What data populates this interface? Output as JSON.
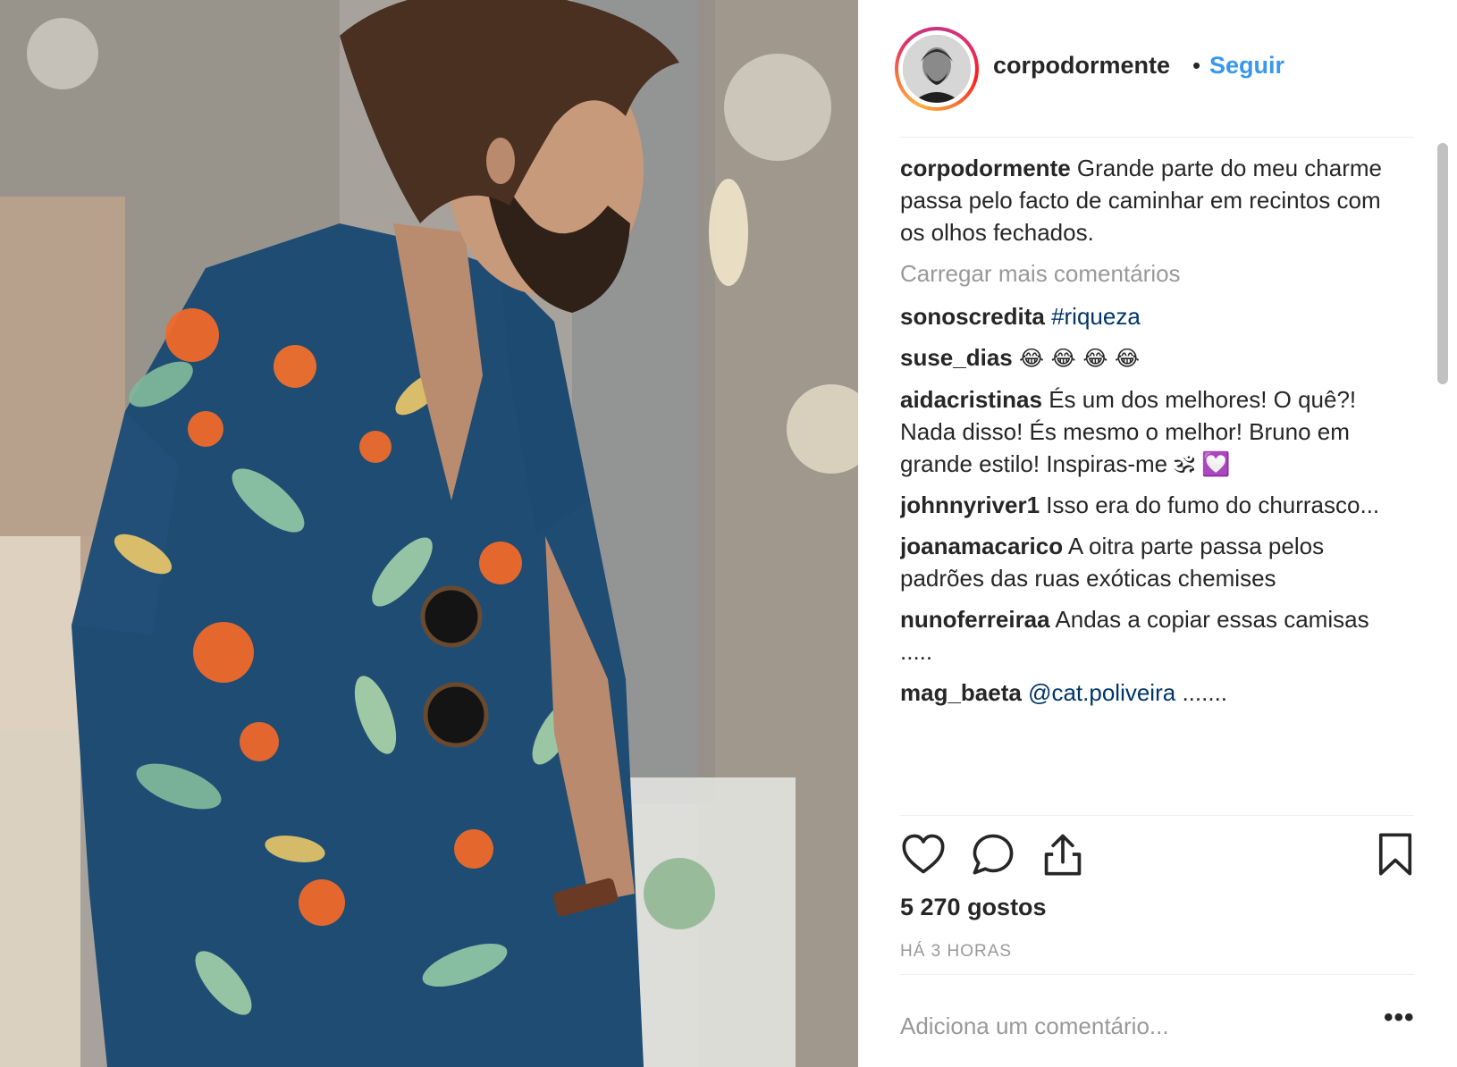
{
  "colors": {
    "accent_link": "#3897f0",
    "hashtag": "#003569",
    "muted": "#999999",
    "text": "#262626"
  },
  "header": {
    "username": "corpodormente",
    "separator": "•",
    "follow_label": "Seguir"
  },
  "caption": {
    "user": "corpodormente",
    "text": "Grande parte do meu charme passa pelo facto de caminhar em recintos com os olhos fechados."
  },
  "load_more": "Carregar mais comentários",
  "comments": [
    {
      "user": "sonoscredita",
      "tag": "#riqueza",
      "text": ""
    },
    {
      "user": "suse_dias",
      "text": "😂 😂 😂 😂"
    },
    {
      "user": "aidacristinas",
      "text": "És um dos melhores! O quê?! Nada disso! És mesmo o melhor! Bruno em grande estilo! Inspiras-me 🕉 💟"
    },
    {
      "user": "johnnyriver1",
      "text": "Isso era do fumo do churrasco..."
    },
    {
      "user": "joanamacarico",
      "text": "A oitra parte passa pelos padrões das ruas exóticas chemises"
    },
    {
      "user": "nunoferreiraa",
      "text": "Andas a copiar essas camisas ....."
    },
    {
      "user": "mag_baeta",
      "tag": "@cat.poliveira",
      "text": "......."
    }
  ],
  "actions": {
    "like_icon": "heart-icon",
    "comment_icon": "comment-icon",
    "share_icon": "share-icon",
    "save_icon": "bookmark-icon"
  },
  "likes": "5 270 gostos",
  "timestamp": "HÁ 3 HORAS",
  "add_comment_placeholder": "Adiciona um comentário...",
  "more_label": "•••"
}
